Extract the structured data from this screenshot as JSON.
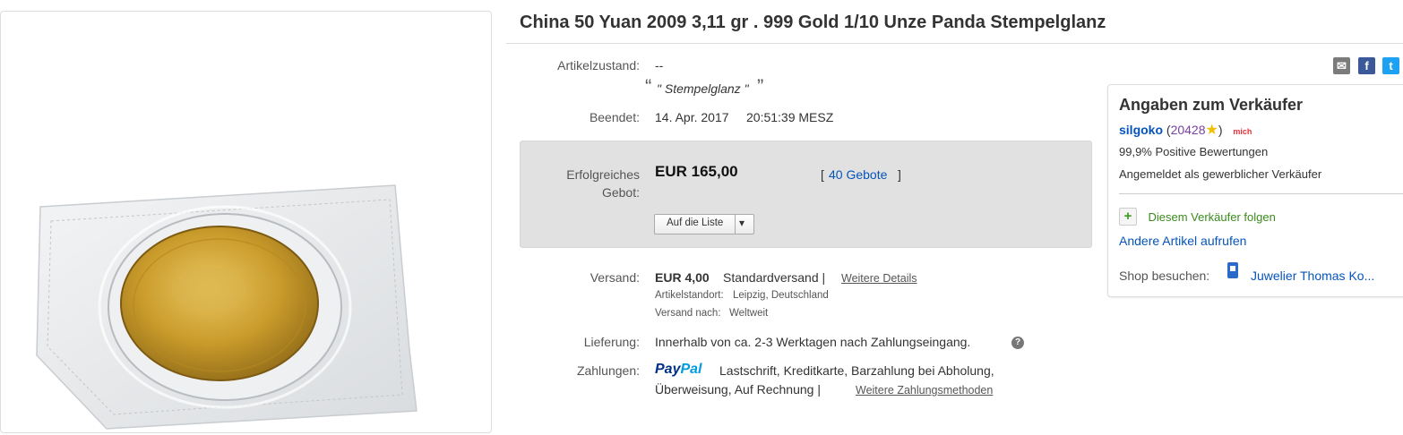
{
  "title": "China 50 Yuan 2009 3,11 gr . 999 Gold 1/10 Unze Panda Stempelglanz",
  "condition": {
    "label": "Artikelzustand:",
    "value": "--",
    "quote_open": "“",
    "quote_text": "\" Stempelglanz \"",
    "quote_close": "”"
  },
  "ended": {
    "label": "Beendet:",
    "date": "14. Apr. 2017",
    "time": "20:51:39 MESZ"
  },
  "bid": {
    "label_line1": "Erfolgreiches",
    "label_line2": "Gebot:",
    "price": "EUR 165,00",
    "bids_open": "[",
    "bids_link": "40 Gebote",
    "bids_close": "]",
    "watch_button": "Auf die Liste",
    "watch_arrow": "▾"
  },
  "shipping": {
    "label": "Versand:",
    "price": "EUR 4,00",
    "method": "Standardversand |",
    "details_link": "Weitere Details",
    "location_label": "Artikelstandort:",
    "location": "Leipzig, Deutschland",
    "ships_to_label": "Versand nach:",
    "ships_to": "Weltweit"
  },
  "delivery": {
    "label": "Lieferung:",
    "value": "Innerhalb von ca. 2-3 Werktagen nach Zahlungseingang.",
    "help": "?"
  },
  "payments": {
    "label": "Zahlungen:",
    "paypal_1": "Pay",
    "paypal_2": "Pal",
    "line1": "Lastschrift,  Kreditkarte,  Barzahlung bei Abholung,",
    "line2": "Überweisung,  Auf Rechnung  |",
    "more_link": "Weitere Zahlungsmethoden"
  },
  "share_icons": [
    {
      "name": "email-icon",
      "glyph": "✉",
      "color": "#7b7b7b"
    },
    {
      "name": "facebook-icon",
      "glyph": "f",
      "color": "#3b5998"
    },
    {
      "name": "twitter-icon",
      "glyph": "t",
      "color": "#1da1f2"
    }
  ],
  "seller": {
    "heading": "Angaben zum Verkäufer",
    "name": "silgoko",
    "paren_open": "(",
    "score": "20428",
    "paren_close": ")",
    "me_badge": "mich",
    "positive": "99,9% Positive Bewertungen",
    "business": "Angemeldet als gewerblicher Verkäufer",
    "follow": "Diesem Verkäufer folgen",
    "other_items": "Andere Artikel aufrufen",
    "shop_label": "Shop besuchen:",
    "shop_name": "Juwelier Thomas Ko..."
  }
}
